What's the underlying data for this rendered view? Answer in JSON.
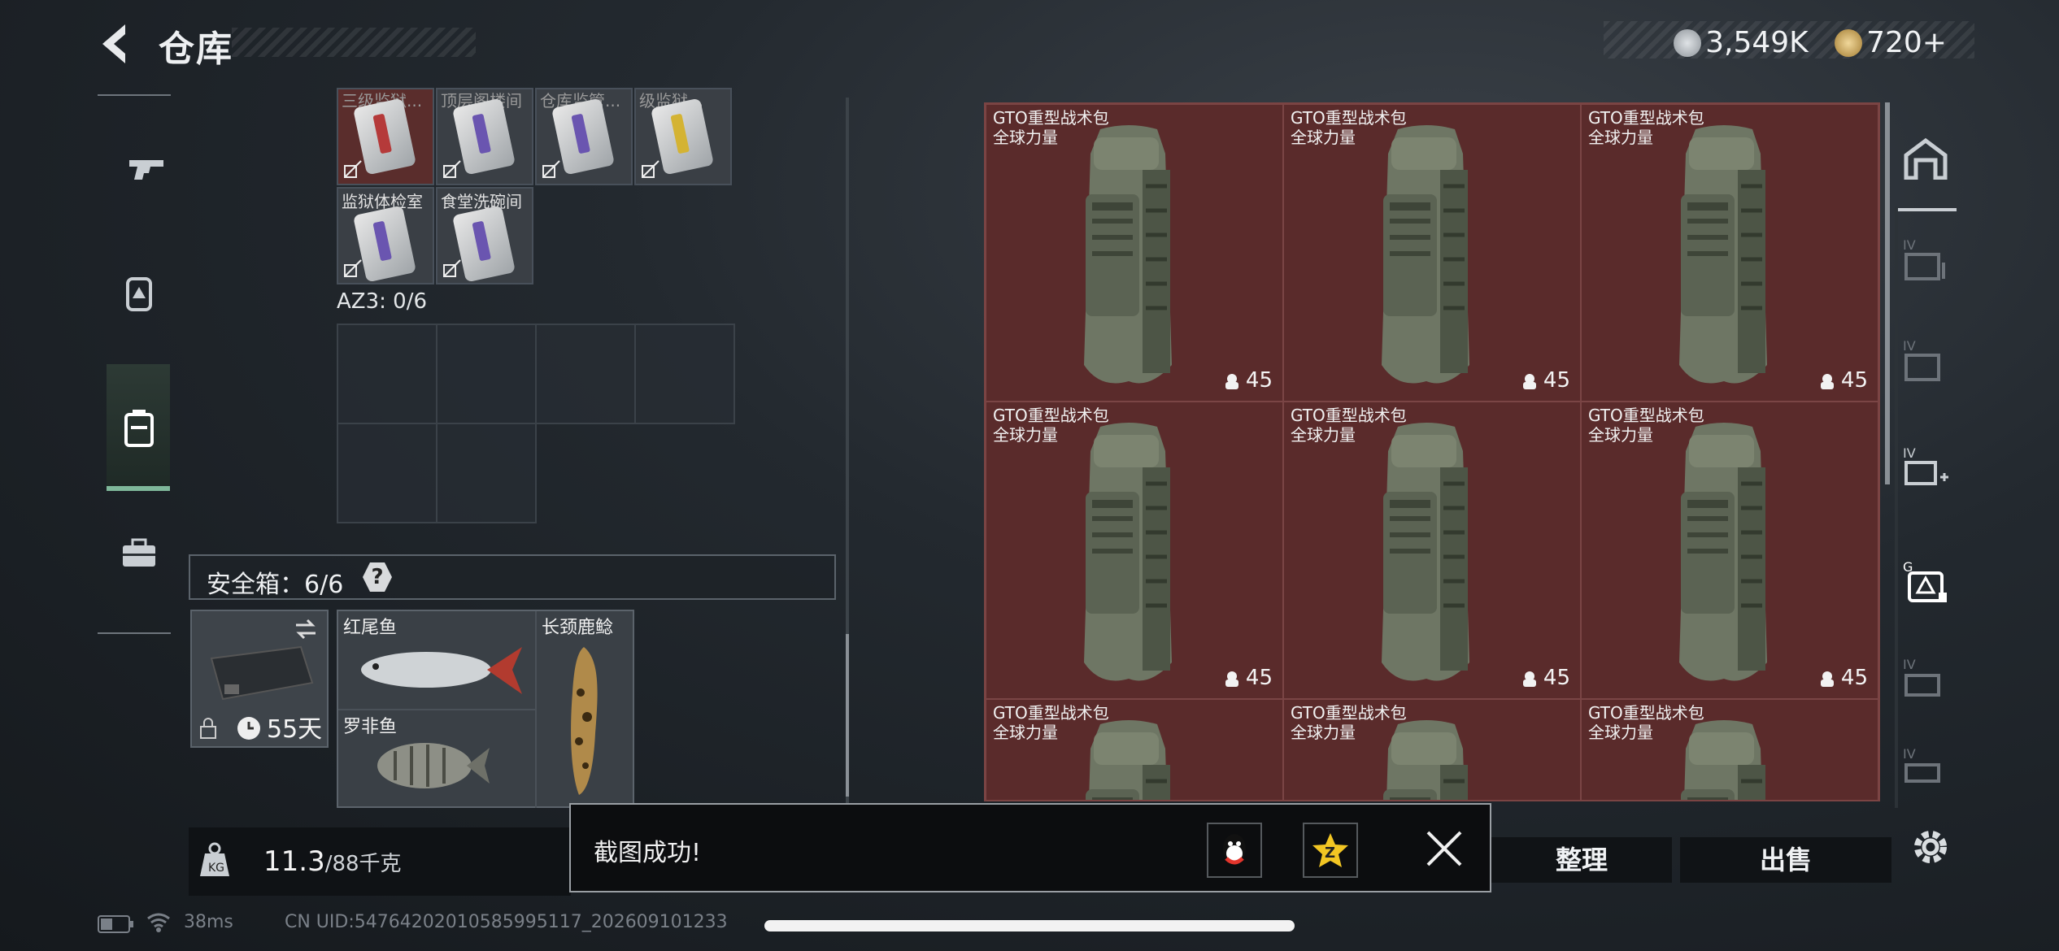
{
  "header": {
    "title": "仓库",
    "currency_silver": "3,549K",
    "currency_gold": "720+",
    "add_symbol": "+"
  },
  "left_panel": {
    "key_row1_labels": [
      "三级监狱...",
      "顶层阁楼间",
      "仓库监管...",
      "级监狱..."
    ],
    "key_row2_labels": [
      "监狱体检室",
      "食堂洗碗间"
    ],
    "az3_label": "AZ3: 0/6",
    "secure_label": "安全箱：6/6",
    "secure_help": "?",
    "case_days": "55天",
    "fish": {
      "red_tail": "红尾鱼",
      "giraffe_catfish": "长颈鹿鲶",
      "tilapia": "罗非鱼"
    },
    "weight_current": "11.3",
    "weight_total": "/88千克"
  },
  "storage": {
    "items": [
      {
        "name": "GTO重型战术包",
        "sub": "全球力量",
        "count": "45"
      },
      {
        "name": "GTO重型战术包",
        "sub": "全球力量",
        "count": "45"
      },
      {
        "name": "GTO重型战术包",
        "sub": "全球力量",
        "count": "45"
      },
      {
        "name": "GTO重型战术包",
        "sub": "全球力量",
        "count": "45"
      },
      {
        "name": "GTO重型战术包",
        "sub": "全球力量",
        "count": "45"
      },
      {
        "name": "GTO重型战术包",
        "sub": "全球力量",
        "count": "45"
      },
      {
        "name": "GTO重型战术包",
        "sub": "全球力量",
        "count": ""
      },
      {
        "name": "GTO重型战术包",
        "sub": "全球力量",
        "count": ""
      },
      {
        "name": "GTO重型战术包",
        "sub": "全球力量",
        "count": ""
      }
    ]
  },
  "buttons": {
    "arrange": "整理",
    "sell": "出售"
  },
  "toast": {
    "message": "截图成功!"
  },
  "status": {
    "ping": "38ms",
    "uid": "CN UID:5476420201058599511​7_202609101233"
  },
  "colors": {
    "bag_cell": "#5a2b2b",
    "rail_active": "#7fb89a",
    "toast_bg": "#0c0d0f"
  }
}
